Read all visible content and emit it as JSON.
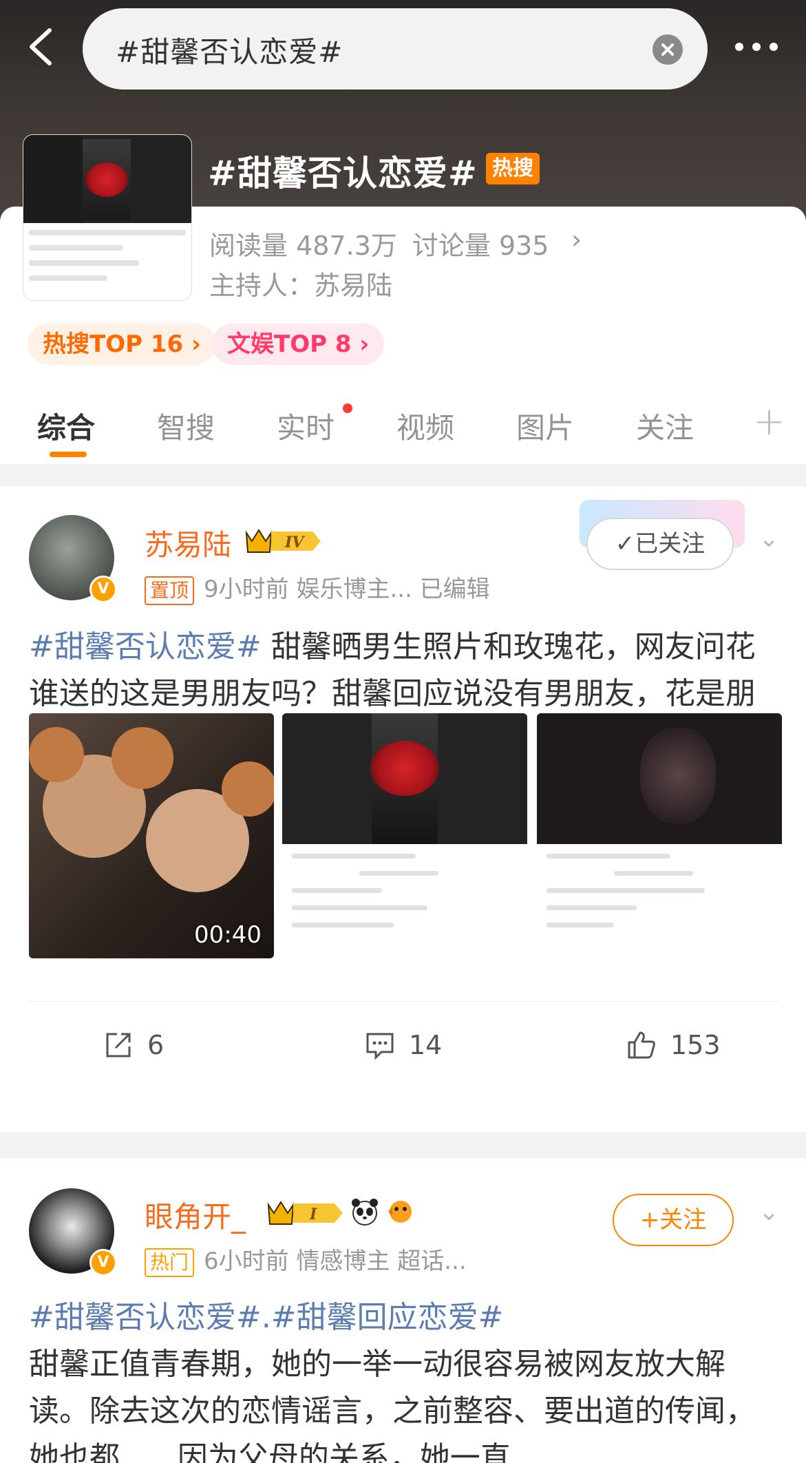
{
  "search": {
    "query": "#甜馨否认恋爱#"
  },
  "topic": {
    "title": "#甜馨否认恋爱#",
    "hot_badge": "热搜",
    "reads": "阅读量 487.3万",
    "discussions": "讨论量 935",
    "host": "主持人：苏易陆",
    "ranks": [
      "热搜TOP 16",
      "文娱TOP 8"
    ]
  },
  "tabs": [
    "综合",
    "智搜",
    "实时",
    "视频",
    "图片",
    "关注"
  ],
  "posts": [
    {
      "author": "苏易陆",
      "level": "IV",
      "tag": "置顶",
      "meta": "9小时前  娱乐博主...  已编辑",
      "follow_label": "✓已关注",
      "hashtag": "#甜馨否认恋爱#",
      "text": "甜馨晒男生照片和玫瑰花，网友问花谁送的这是男朋友吗？甜馨回应说没有男朋友，花是朋友送的。",
      "video_duration": "00:40",
      "reposts": "6",
      "comments": "14",
      "likes": "153"
    },
    {
      "author": "眼角开_",
      "level": "I",
      "tag": "热门",
      "meta": "6小时前  情感博主 超话...",
      "follow_label": "+关注",
      "hashtag": "#甜馨否认恋爱#.#甜馨回应恋爱#",
      "text": "甜馨正值青春期，她的一举一动很容易被网友放大解读。除去这次的恋情谣言，之前整容、要出道的传闻，她也都......因为父母的关系，她一直"
    }
  ]
}
